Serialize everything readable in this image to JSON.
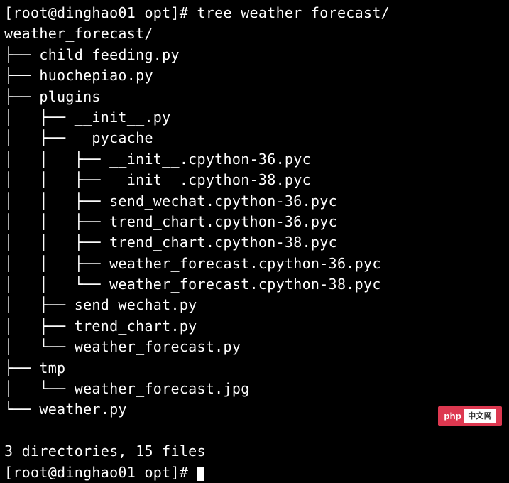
{
  "prompt": {
    "user": "root",
    "host": "dinghao01",
    "cwd": "opt",
    "command": "tree weather_forecast/"
  },
  "tree": {
    "root": "weather_forecast/",
    "entries": [
      "├── child_feeding.py",
      "├── huochepiao.py",
      "├── plugins",
      "│   ├── __init__.py",
      "│   ├── __pycache__",
      "│   │   ├── __init__.cpython-36.pyc",
      "│   │   ├── __init__.cpython-38.pyc",
      "│   │   ├── send_wechat.cpython-36.pyc",
      "│   │   ├── trend_chart.cpython-36.pyc",
      "│   │   ├── trend_chart.cpython-38.pyc",
      "│   │   ├── weather_forecast.cpython-36.pyc",
      "│   │   └── weather_forecast.cpython-38.pyc",
      "│   ├── send_wechat.py",
      "│   ├── trend_chart.py",
      "│   └── weather_forecast.py",
      "├── tmp",
      "│   └── weather_forecast.jpg",
      "└── weather.py"
    ]
  },
  "summary": "3 directories, 15 files",
  "prompt2_prefix": "[root@dinghao01 opt]# ",
  "watermark": {
    "left": "php",
    "right": "中文网"
  }
}
